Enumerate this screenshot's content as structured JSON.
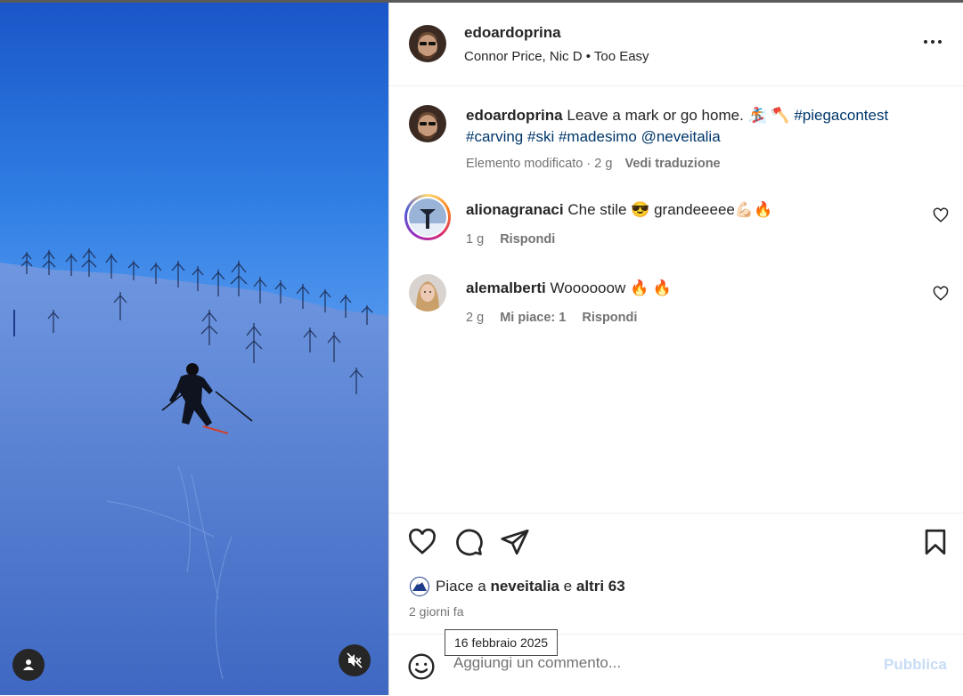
{
  "post": {
    "username": "edoardoprina",
    "audio": "Connor Price, Nic D • Too Easy"
  },
  "caption": {
    "username": "edoardoprina",
    "text": "Leave a mark or go home. 🏂 🪓",
    "tags": [
      "#piegacontest",
      "#carving",
      "#ski",
      "#madesimo",
      "@neveitalia"
    ],
    "meta": "Elemento modificato · 2 g",
    "translate_label": "Vedi traduzione"
  },
  "comments": [
    {
      "username": "alionagranaci",
      "text": "Che stile 😎 grandeeeee💪🏻🔥",
      "time": "1 g",
      "reply_label": "Rispondi"
    },
    {
      "username": "alemalberti",
      "text": "Woooooow 🔥 🔥",
      "time": "2 g",
      "likes_label": "Mi piace: 1",
      "reply_label": "Rispondi"
    }
  ],
  "likes": {
    "prefix": "Piace a",
    "first_user": "neveitalia",
    "joiner": "e",
    "others": "altri 63"
  },
  "time_ago": "2 giorni fa",
  "tooltip": "16 febbraio 2025",
  "add_comment": {
    "placeholder": "Aggiungi un commento...",
    "publish_label": "Pubblica"
  },
  "icons": {
    "more": "more-horizontal-icon",
    "like": "heart-icon",
    "comment": "comment-icon",
    "share": "paper-plane-icon",
    "save": "bookmark-icon",
    "emoji": "smiley-icon",
    "tag": "user-tag-icon",
    "mute": "speaker-muted-icon"
  },
  "colors": {
    "hashtag": "#00376b",
    "muted_text": "#737373",
    "publish_disabled": "#c7dcf5"
  }
}
